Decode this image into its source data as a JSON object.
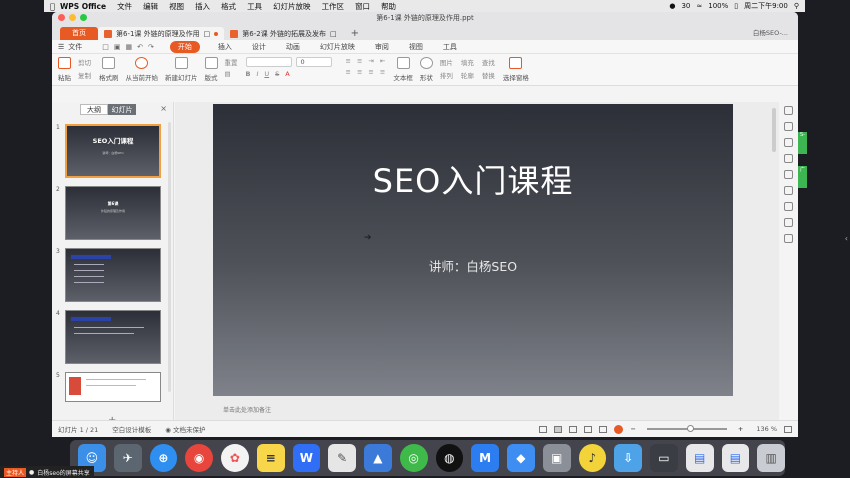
{
  "menubar": {
    "app": "WPS Office",
    "items": [
      "文件",
      "编辑",
      "视图",
      "插入",
      "格式",
      "工具",
      "幻灯片放映",
      "工作区",
      "窗口",
      "帮助"
    ],
    "status": {
      "battery": "100%",
      "wechat_count": "30",
      "datetime": "周二下午9:00"
    }
  },
  "window": {
    "title": "第6-1课 外链的原理及作用.ppt",
    "home_tab": "首页",
    "tabs": [
      "第6-1课 外链的原理及作用",
      "第6-2课 外链的拓展及发布"
    ],
    "new_tab": "+",
    "user": "白杨SEO-..."
  },
  "ribbon_tabs": {
    "file": "文件",
    "items": [
      "开始",
      "插入",
      "设计",
      "动画",
      "幻灯片放映",
      "审阅",
      "视图",
      "工具"
    ],
    "active": "开始"
  },
  "ribbon": {
    "paste": "粘贴",
    "cut": "剪切",
    "copy": "复制",
    "format_painter": "格式刷",
    "from_current": "从当前开始",
    "new_slide": "新建幻灯片",
    "layout": "版式",
    "reset": "重置",
    "font_size": "0",
    "textbox": "文本框",
    "shape": "形状",
    "picture": "图片",
    "fill": "填充",
    "arrange": "排列",
    "outline": "轮廓",
    "find": "查找",
    "replace": "替换",
    "select_pane": "选择窗格"
  },
  "sidepanel": {
    "tabs": [
      "大纲",
      "幻灯片"
    ],
    "active_tab": "幻灯片",
    "close": "×",
    "add": "+",
    "thumbnails": [
      {
        "num": "1",
        "title": "SEO入门课程",
        "sub": "讲师：白杨SEO"
      },
      {
        "num": "2",
        "title": "第6课",
        "sub": "外链的原理及作用"
      },
      {
        "num": "3",
        "title": "",
        "sub": ""
      },
      {
        "num": "4",
        "title": "",
        "sub": ""
      },
      {
        "num": "5",
        "title": "",
        "sub": ""
      }
    ]
  },
  "slide": {
    "title": "SEO入门课程",
    "subtitle": "讲师：白杨SEO"
  },
  "notes_placeholder": "单击此处添加备注",
  "statusbar": {
    "slide_count": "幻灯片 1 / 21",
    "template": "空白设计模板",
    "protect": "文档未保护",
    "zoom": "136 %",
    "zoom_level": 0.55
  },
  "right_tabs": [
    "S-",
    "广"
  ],
  "share_bar": {
    "host": "主持人",
    "text": "白杨seo的屏幕共享"
  },
  "colors": {
    "accent": "#e85a24",
    "green": "#3cb552"
  }
}
